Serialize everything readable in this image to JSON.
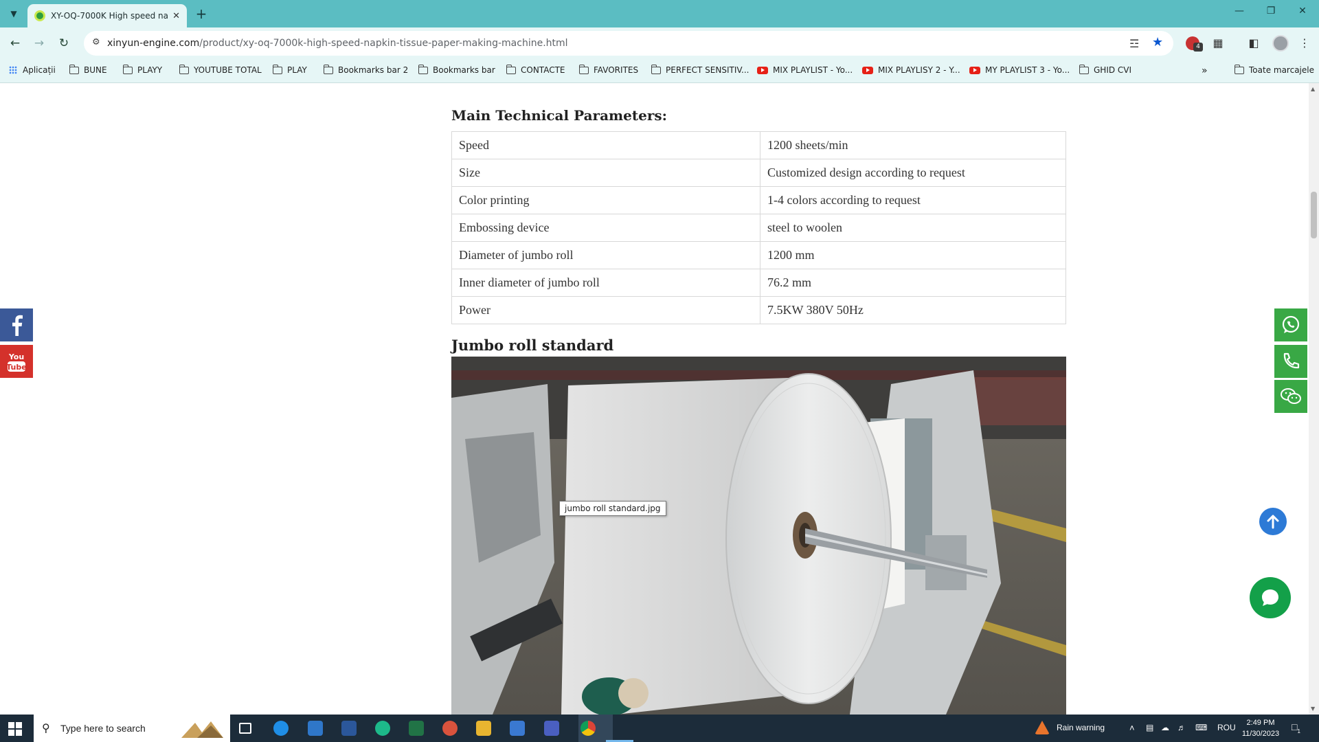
{
  "browser": {
    "tab_title": "XY-OQ-7000K High speed nap",
    "url_domain": "xinyun-engine.com",
    "url_path": "/product/xy-oq-7000k-high-speed-napkin-tissue-paper-making-machine.html",
    "bookmarks": [
      {
        "label": "Aplicații",
        "icon": "apps-icon"
      },
      {
        "label": "BUNE",
        "icon": "folder-icon"
      },
      {
        "label": "PLAYY",
        "icon": "folder-icon"
      },
      {
        "label": "YOUTUBE TOTAL",
        "icon": "folder-icon"
      },
      {
        "label": "PLAY",
        "icon": "folder-icon"
      },
      {
        "label": "Bookmarks bar 2",
        "icon": "folder-icon"
      },
      {
        "label": "Bookmarks bar",
        "icon": "folder-icon"
      },
      {
        "label": "CONTACTE",
        "icon": "folder-icon"
      },
      {
        "label": "FAVORITES",
        "icon": "folder-icon"
      },
      {
        "label": "PERFECT SENSITIV...",
        "icon": "folder-icon"
      },
      {
        "label": "MIX PLAYLIST - Yo...",
        "icon": "youtube-icon"
      },
      {
        "label": "MIX PLAYLISY 2 - Y...",
        "icon": "youtube-icon"
      },
      {
        "label": "MY PLAYLIST 3 - Yo...",
        "icon": "youtube-icon"
      },
      {
        "label": "GHID CVI",
        "icon": "folder-icon"
      }
    ],
    "all_bookmarks": "Toate marcajele",
    "extension_badge": "4"
  },
  "page": {
    "params_heading": "Main Technical Parameters:",
    "params": [
      {
        "name": "Speed",
        "value": "1200 sheets/min"
      },
      {
        "name": "Size",
        "value": "Customized design according to request"
      },
      {
        "name": "Color printing",
        "value": "1-4 colors according to request"
      },
      {
        "name": "Embossing device",
        "value": "steel to woolen"
      },
      {
        "name": "Diameter of jumbo roll",
        "value": "1200 mm"
      },
      {
        "name": "Inner diameter of jumbo roll",
        "value": "76.2 mm"
      },
      {
        "name": "Power",
        "value": "7.5KW 380V 50Hz"
      }
    ],
    "jumbo_heading": "Jumbo roll standard",
    "image_tooltip": "jumbo roll standard.jpg"
  },
  "taskbar": {
    "search_placeholder": "Type here to search",
    "weather": "Rain warning",
    "language": "ROU",
    "time": "2:49 PM",
    "date": "11/30/2023",
    "notification_count": "1"
  },
  "colors": {
    "chrome_frame": "#5bbdc2",
    "facebook": "#3b5998",
    "youtube": "#d4312b",
    "social_green": "#39a845"
  }
}
